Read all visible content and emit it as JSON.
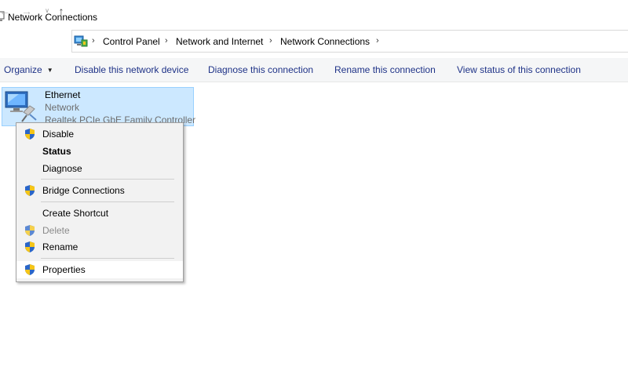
{
  "window": {
    "title": "Network Connections",
    "title_icon": "network-connections-icon"
  },
  "navigation": {
    "back_icon": "back-arrow-icon",
    "forward_icon": "forward-arrow-icon",
    "recent_icon": "chevron-down-icon",
    "up_icon": "up-arrow-icon"
  },
  "address": {
    "location_icon": "control-panel-icon",
    "breadcrumbs": [
      "Control Panel",
      "Network and Internet",
      "Network Connections"
    ],
    "separator": "›"
  },
  "commandbar": {
    "organize": "Organize",
    "disable": "Disable this network device",
    "diagnose": "Diagnose this connection",
    "rename": "Rename this connection",
    "view_status": "View status of this connection"
  },
  "item": {
    "name": "Ethernet",
    "status": "Network",
    "device": "Realtek PCIe GbE Family Controller",
    "icon": "ethernet-adapter-icon"
  },
  "context_menu": {
    "items": [
      {
        "label": "Disable",
        "shield": true,
        "bold": false,
        "disabled": false
      },
      {
        "label": "Status",
        "shield": false,
        "bold": true,
        "disabled": false
      },
      {
        "label": "Diagnose",
        "shield": false,
        "bold": false,
        "disabled": false
      },
      {
        "label": "Bridge Connections",
        "shield": true,
        "bold": false,
        "disabled": false
      },
      {
        "label": "Create Shortcut",
        "shield": false,
        "bold": false,
        "disabled": false
      },
      {
        "label": "Delete",
        "shield": true,
        "bold": false,
        "disabled": true
      },
      {
        "label": "Rename",
        "shield": true,
        "bold": false,
        "disabled": false
      },
      {
        "label": "Properties",
        "shield": true,
        "bold": false,
        "disabled": false,
        "highlighted": true
      }
    ]
  },
  "colors": {
    "link_blue": "#1e3287",
    "selection_fill": "#cce8ff",
    "selection_border": "#99d1ff",
    "menu_background": "#f2f2f2",
    "shield_blue": "#2a66c9",
    "shield_yellow": "#f5c518"
  }
}
